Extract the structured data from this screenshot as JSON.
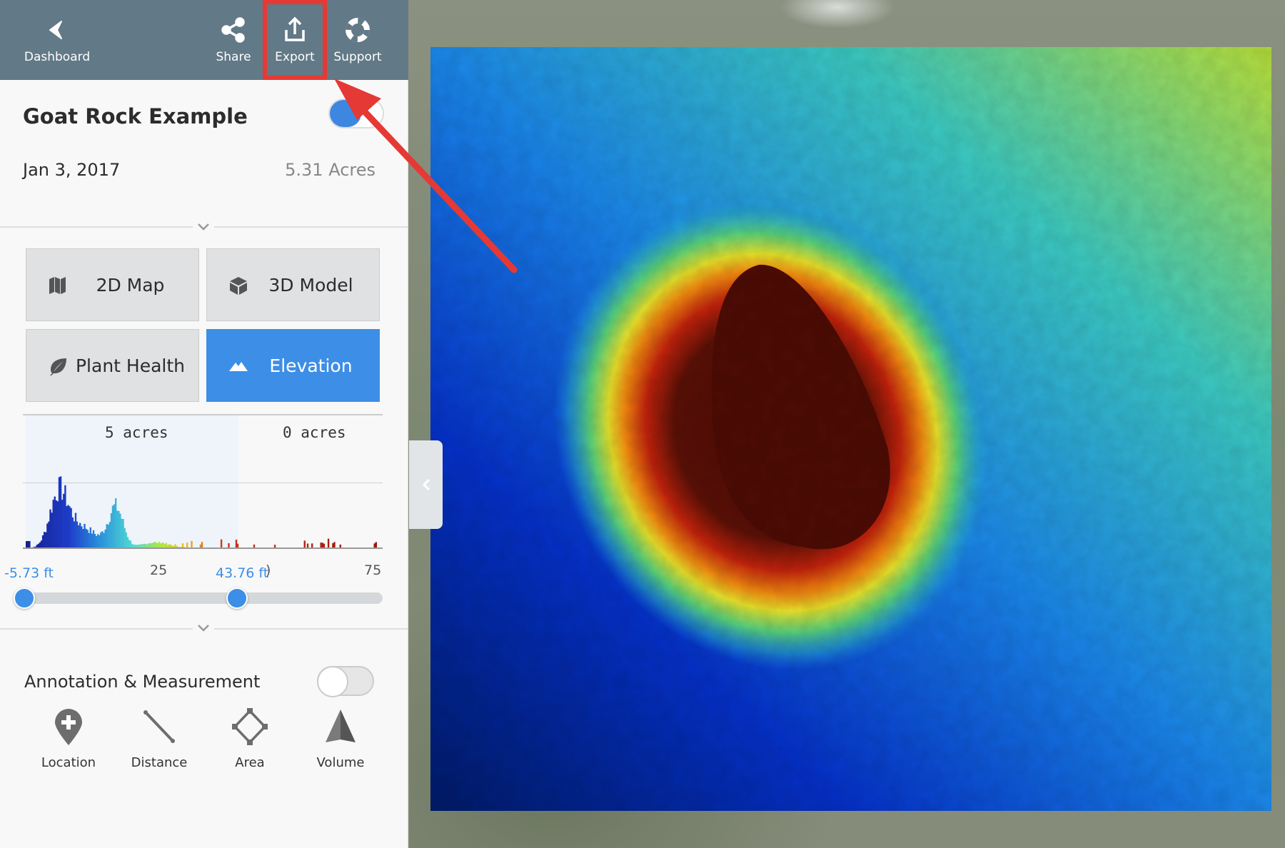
{
  "topbar": {
    "dashboard_label": "Dashboard",
    "share_label": "Share",
    "export_label": "Export",
    "support_label": "Support"
  },
  "project": {
    "title": "Goat Rock Example",
    "date": "Jan 3, 2017",
    "area": "5.31 Acres"
  },
  "modes": [
    {
      "label": "2D Map",
      "icon": "map-icon"
    },
    {
      "label": "3D Model",
      "icon": "cube-icon"
    },
    {
      "label": "Plant Health",
      "icon": "leaf-icon"
    },
    {
      "label": "Elevation",
      "icon": "mountain-icon",
      "active": true
    }
  ],
  "histogram": {
    "left_label": "5 acres",
    "right_label": "0 acres",
    "ticks": [
      "25",
      ")",
      "75"
    ],
    "range_min": "-5.73 ft",
    "range_max": "43.76 ft"
  },
  "annotation": {
    "title": "Annotation & Measurement",
    "toggle_on": false,
    "tools": [
      {
        "label": "Location",
        "icon": "location-pin-icon"
      },
      {
        "label": "Distance",
        "icon": "ruler-line-icon"
      },
      {
        "label": "Area",
        "icon": "polygon-icon"
      },
      {
        "label": "Volume",
        "icon": "cone-icon"
      }
    ]
  },
  "colors": {
    "accent": "#3d8ee6",
    "highlight": "#e53935",
    "topbar": "#627987"
  }
}
